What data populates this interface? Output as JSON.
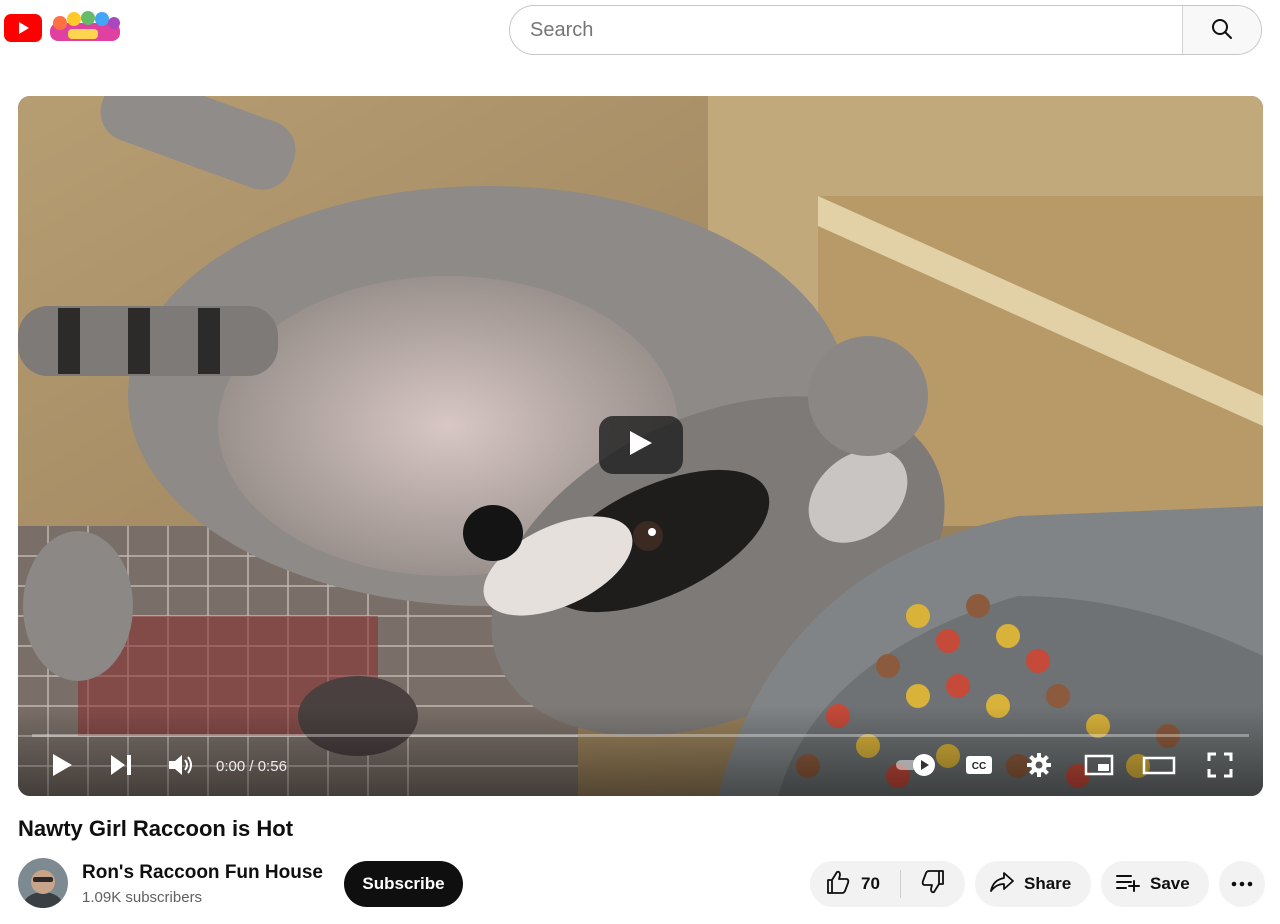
{
  "header": {
    "search": {
      "placeholder": "Search",
      "value": ""
    }
  },
  "player": {
    "time_current": "0:00",
    "time_separator": " / ",
    "time_total": "0:56",
    "progress_fraction": 0.0
  },
  "video": {
    "title": "Nawty Girl Raccoon is Hot"
  },
  "channel": {
    "name": "Ron's Raccoon Fun House",
    "subscribers": "1.09K subscribers",
    "subscribe_label": "Subscribe"
  },
  "actions": {
    "like_count": "70",
    "share_label": "Share",
    "save_label": "Save"
  },
  "colors": {
    "brand_red": "#ff0000",
    "button_dark": "#0f0f0f",
    "pill_bg": "#f2f2f2"
  },
  "icons": [
    "youtube-logo",
    "youtube-kids-logo",
    "search-icon",
    "play-icon",
    "next-icon",
    "volume-icon",
    "autoplay-toggle-icon",
    "captions-icon",
    "settings-icon",
    "miniplayer-icon",
    "theater-icon",
    "fullscreen-icon",
    "like-icon",
    "dislike-icon",
    "share-icon",
    "save-icon",
    "more-icon"
  ]
}
